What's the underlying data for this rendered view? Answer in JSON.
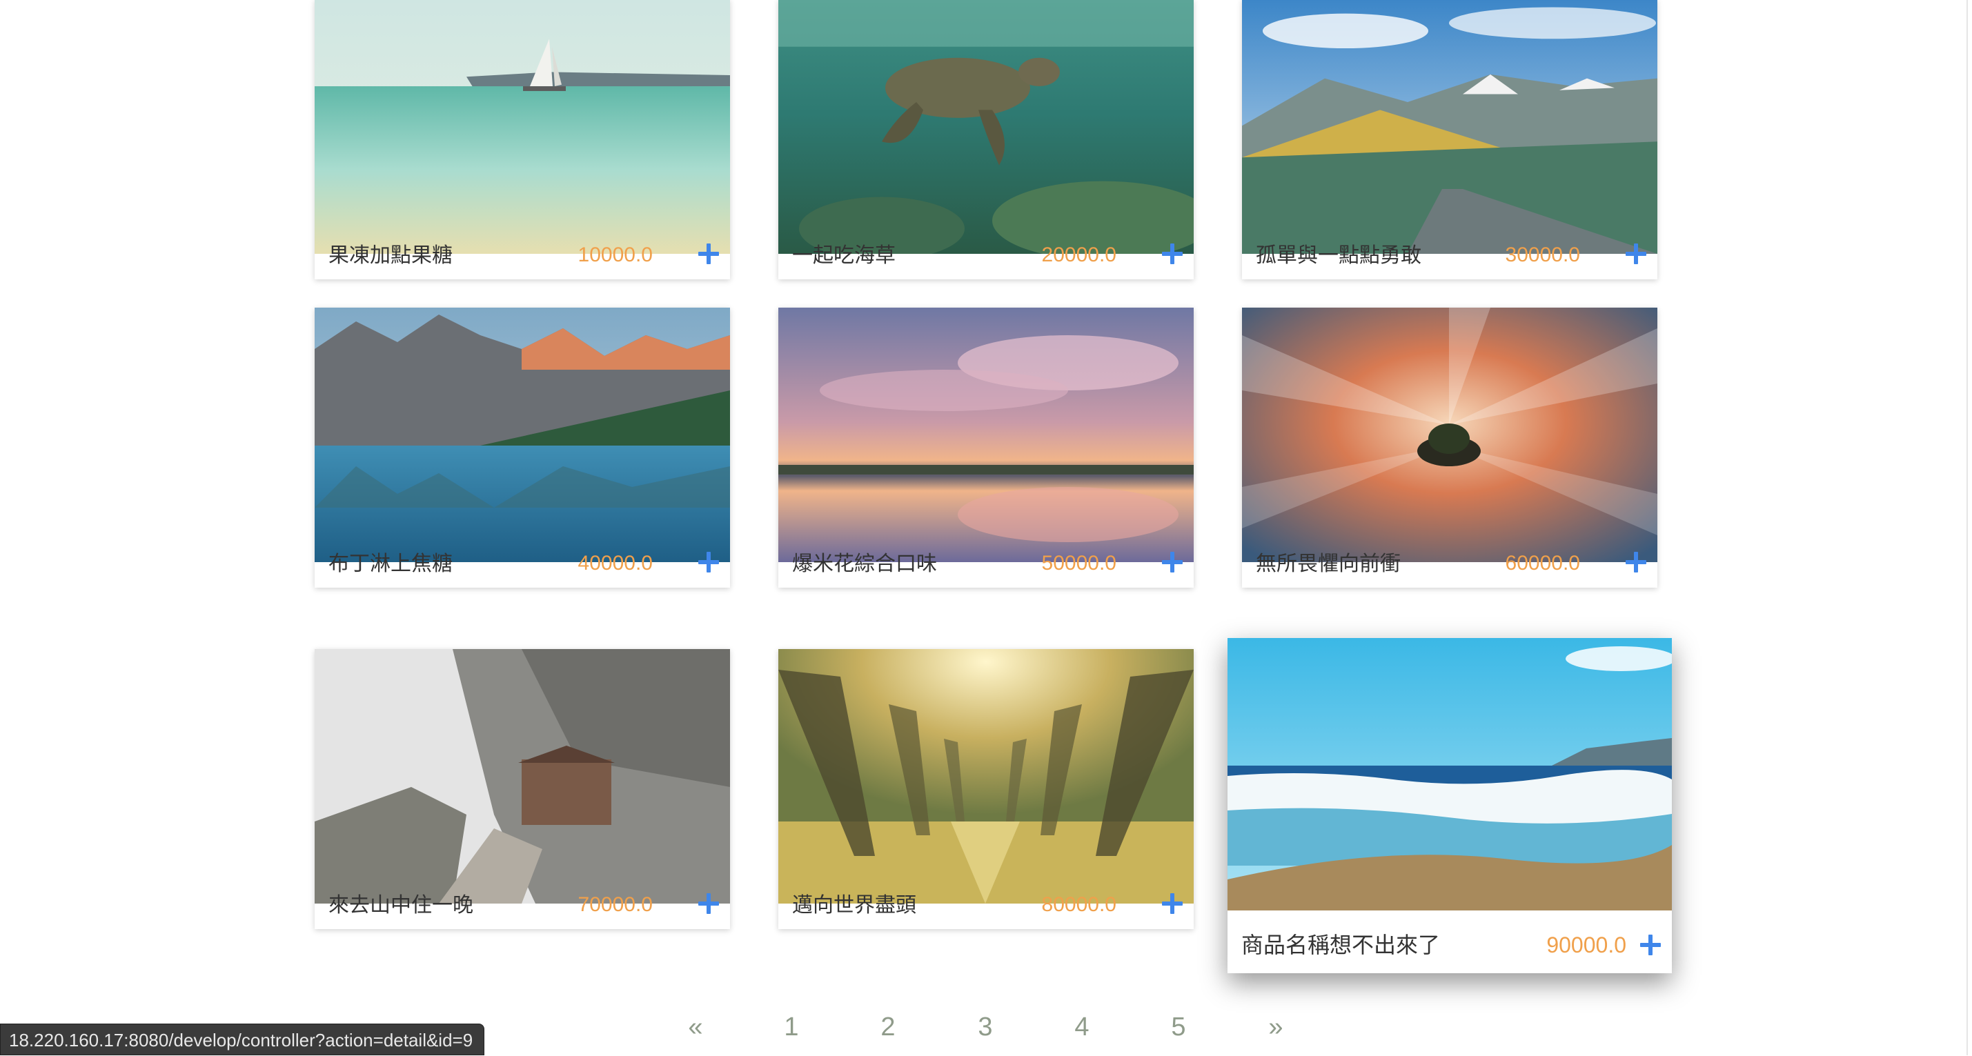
{
  "products": [
    {
      "name": "果凍加點果糖",
      "price": "10000.0",
      "image": "sailboat-sea",
      "plus_icon": "plus-icon"
    },
    {
      "name": "一起吃海草",
      "price": "20000.0",
      "image": "sea-turtle",
      "plus_icon": "plus-icon"
    },
    {
      "name": "孤單與一點點勇敢",
      "price": "30000.0",
      "image": "mountain-road",
      "plus_icon": "plus-icon"
    },
    {
      "name": "布丁淋上焦糖",
      "price": "40000.0",
      "image": "mountain-lake",
      "plus_icon": "plus-icon"
    },
    {
      "name": "爆米花綜合口味",
      "price": "50000.0",
      "image": "cloud-reflection",
      "plus_icon": "plus-icon"
    },
    {
      "name": "無所畏懼向前衝",
      "price": "60000.0",
      "image": "island-sunset",
      "plus_icon": "plus-icon"
    },
    {
      "name": "來去山中住一晚",
      "price": "70000.0",
      "image": "cliff-house",
      "plus_icon": "plus-icon"
    },
    {
      "name": "邁向世界盡頭",
      "price": "80000.0",
      "image": "tree-avenue",
      "plus_icon": "plus-icon"
    },
    {
      "name": "商品名稱想不出來了",
      "price": "90000.0",
      "image": "beach-waves",
      "plus_icon": "plus-icon"
    }
  ],
  "pagination": [
    "«",
    "1",
    "2",
    "3",
    "4",
    "5",
    "»"
  ],
  "status_bar": {
    "url": "18.220.160.17:8080/develop/controller?action=detail&id=9"
  },
  "colors": {
    "price": "#f0a04b",
    "plus": "#3f86ea",
    "pager": "#8f9b8a"
  }
}
